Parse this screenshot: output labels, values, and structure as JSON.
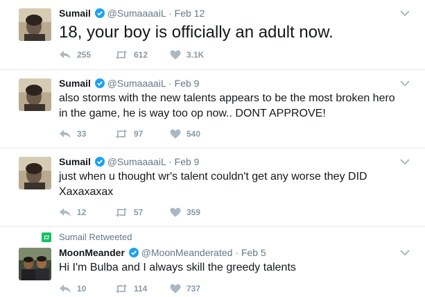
{
  "tweets": [
    {
      "name": "Sumail",
      "handle": "@SumaaaaiL",
      "dot": "·",
      "date": "Feb 12",
      "text": "18, your boy is officially an adult now.",
      "replies": "255",
      "retweets": "612",
      "likes": "3.1K"
    },
    {
      "name": "Sumail",
      "handle": "@SumaaaaiL",
      "dot": "·",
      "date": "Feb 9",
      "text": "also storms with the new talents appears to be the most broken hero in the game, he is way too op now.. DONT APPROVE!",
      "replies": "33",
      "retweets": "97",
      "likes": "540"
    },
    {
      "name": "Sumail",
      "handle": "@SumaaaaiL",
      "dot": "·",
      "date": "Feb 9",
      "text": "just when u thought wr's talent couldn't get any worse they DID Xaxaxaxax",
      "replies": "12",
      "retweets": "57",
      "likes": "359"
    },
    {
      "retweet_context": "Sumail Retweeted",
      "name": "MoonMeander",
      "handle": "@MoonMeanderated",
      "dot": "·",
      "date": "Feb 5",
      "text": "Hi I'm Bulba and I always skill the greedy talents",
      "replies": "10",
      "retweets": "114",
      "likes": "737"
    }
  ],
  "icons": {
    "reply": "reply-icon",
    "retweet": "retweet-icon",
    "like": "heart-icon",
    "verified": "verified-badge-icon",
    "more": "chevron-down-icon"
  },
  "colors": {
    "verified": "#1da1f2",
    "retweet_context": "#17bf63",
    "muted": "#657786",
    "action_icon": "#aab8c2"
  }
}
